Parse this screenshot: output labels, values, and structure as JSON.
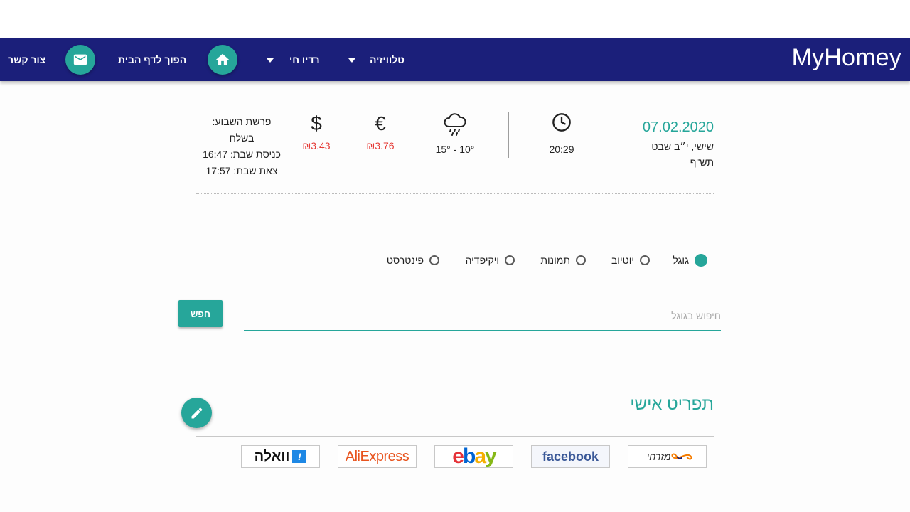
{
  "brand": "MyHomey",
  "nav": {
    "contact": "צור קשר",
    "homepage": "הפוך לדף הבית",
    "radio": "רדיו חי",
    "tv": "טלוויזיה"
  },
  "date": {
    "gregorian": "07.02.2020",
    "hebrew_line1": "שישי, י״ב שבט",
    "hebrew_line2": "תש\"ף"
  },
  "clock": {
    "time": "20:29"
  },
  "weather": {
    "range": "10° - 15°"
  },
  "currency": {
    "euro": {
      "symbol": "€",
      "value": "₪3.76"
    },
    "dollar": {
      "symbol": "$",
      "value": "₪3.43"
    },
    "value_color": "#e53935"
  },
  "shabbat": {
    "line1": "פרשת השבוע:",
    "line2": "בשלח",
    "line3": "כניסת שבת: 16:47",
    "line4": "צאת שבת: 17:57"
  },
  "search": {
    "engines": [
      "גוגל",
      "יוטיוב",
      "תמונות",
      "ויקיפדיה",
      "פינטרסט"
    ],
    "selected": "גוגל",
    "placeholder": "חיפוש בגוגל",
    "button": "חפש"
  },
  "personal_menu": {
    "title": "תפריט אישי",
    "links": [
      {
        "name": "mizrahi",
        "text": "מזרחי"
      },
      {
        "name": "facebook",
        "text": "facebook"
      },
      {
        "name": "ebay",
        "text": "ebay"
      },
      {
        "name": "aliexpress",
        "text": "AliExpress"
      },
      {
        "name": "walla",
        "text": "וואלה"
      }
    ]
  },
  "colors": {
    "navbar": "#1b1f7a",
    "accent": "#26a69a"
  },
  "icons": {
    "home": "home-icon",
    "mail": "mail-icon",
    "clock": "clock-icon",
    "weather": "rain-cloud-icon",
    "edit": "pencil-icon"
  }
}
